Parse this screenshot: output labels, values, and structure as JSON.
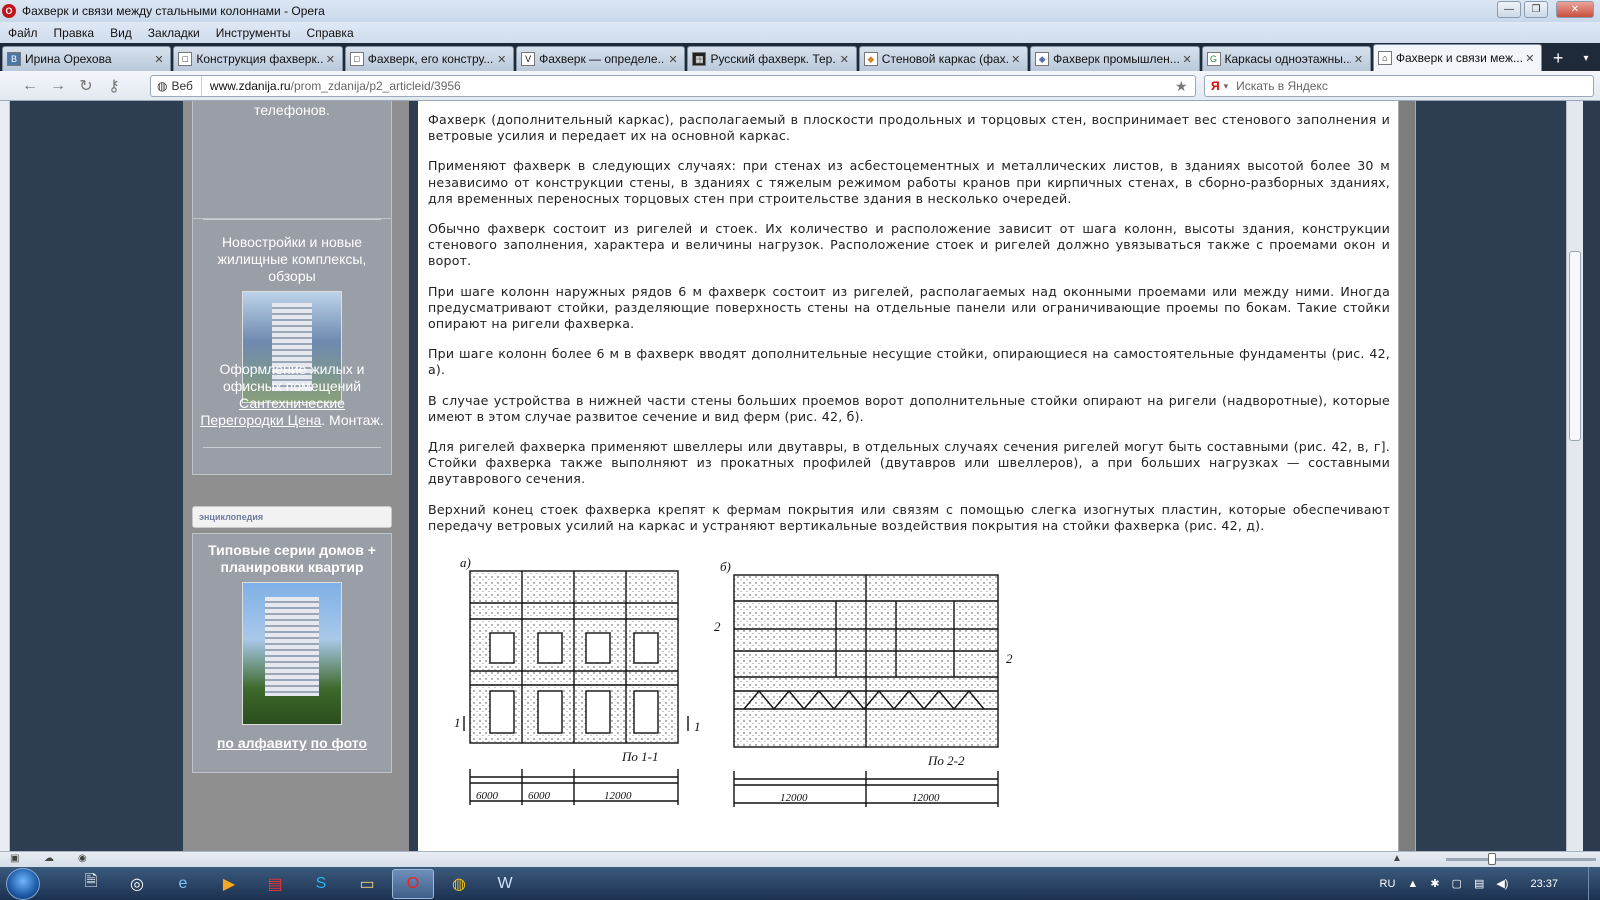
{
  "window": {
    "title": "Фахверк и связи между стальными колоннами - Opera",
    "min": "—",
    "max": "❐",
    "close": "✕"
  },
  "menu": [
    "Файл",
    "Правка",
    "Вид",
    "Закладки",
    "Инструменты",
    "Справка"
  ],
  "tabs": [
    {
      "label": "Ирина Орехова",
      "icon": "B"
    },
    {
      "label": "Конструкция фахверк...",
      "icon": "□"
    },
    {
      "label": "Фахверк, его констру...",
      "icon": "□"
    },
    {
      "label": "Фахверк — определе...",
      "icon": "V"
    },
    {
      "label": "Русский фахверк. Тер...",
      "icon": "▦"
    },
    {
      "label": "Стеновой каркас (фах...",
      "icon": "◆"
    },
    {
      "label": "Фахверк промышлен...",
      "icon": "◆"
    },
    {
      "label": "Каркасы одноэтажны...",
      "icon": "G"
    },
    {
      "label": "Фахверк и связи меж...",
      "icon": "⌂"
    }
  ],
  "address": {
    "web_label": "Веб",
    "domain": "www.zdanija.ru",
    "path": "/prom_zdanija/p2_articleid/3956",
    "search_placeholder": "Искать в Яндекс",
    "search_brand": "Я"
  },
  "sidebar": {
    "top_text": "телефонов.",
    "panel1_title": "Новостройки и новые жилищные комплексы, обзоры",
    "panel2_text": "Оформление жилых и офисных помещений",
    "panel2_link1": "Сантехнические",
    "panel2_link2": "Перегородки Цена",
    "panel2_tail": ". Монтаж.",
    "encyclopedia": "энциклопедия",
    "panel3_title": "Типовые серии домов + планировки квартир",
    "alpha_link": "по алфавиту",
    "photo_link": "по фото"
  },
  "article": {
    "paragraphs": [
      "Фахверк (дополнительный каркас), располагаемый в плоскости продольных и торцовых стен, воспринимает вес стенового заполнения и ветровые усилия и передает их на основной каркас.",
      "Применяют фахверк в следующих случаях: при стенах из асбестоцементных и металлических листов, в зданиях высотой более 30 м независимо от конструкции стены, в зданиях с тяжелым режимом работы кранов при кирпичных стенах, в сборно-разборных зданиях, для временных переносных торцовых стен при строительстве здания в несколько очередей.",
      "Обычно фахверк состоит из ригелей и стоек. Их количество и расположение зависит от шага колонн, высоты здания, конструкции стенового заполнения, характера и величины нагрузок. Расположение стоек и ригелей должно увязываться также с проемами окон и ворот.",
      "При шаге колонн наружных рядов 6 м фахверк состоит из ригелей, располагаемых над оконными проемами или между ними. Иногда предусматривают стойки, разделяющие поверхность стены на отдельные панели или ограничивающие проемы по бокам. Такие стойки опирают на ригели фахверка.",
      "При шаге колонн более 6 м в фахверк вводят дополнительные несущие стойки, опирающиеся на самостоятельные фундаменты (рис. 42, а).",
      "В случае устройства в нижней части стены больших проемов ворот дополнительные стойки опирают на ригели (надворотные), которые имеют в этом случае развитое сечение и вид ферм (рис. 42, б).",
      "Для ригелей фахверка применяют швеллеры или двутавры, в отдельных случаях сечения ригелей могут быть составными (рис. 42, в, г]. Стойки фахверка также выполняют из прокатных профилей (двутавров или швеллеров), а при больших нагрузках — составными двутаврового сечения.",
      "Верхний конец стоек фахверка крепят к фермам покрытия или связям с помощью слегка изогнутых пластин, которые обеспечивают передачу ветровых усилий на каркас и устраняют вертикальные воздействия покрытия на стойки фахверка (рис. 42, д)."
    ],
    "figure": {
      "label_a": "а)",
      "label_b": "б)",
      "sec_a": "По 1-1",
      "sec_b": "По 2-2",
      "mark1": "1",
      "mark2": "2",
      "dim_a1": "6000",
      "dim_a2": "6000",
      "dim_a3": "12000",
      "dim_b1": "12000",
      "dim_b2": "12000"
    }
  },
  "tray": {
    "lang": "RU",
    "time": "23:37"
  }
}
